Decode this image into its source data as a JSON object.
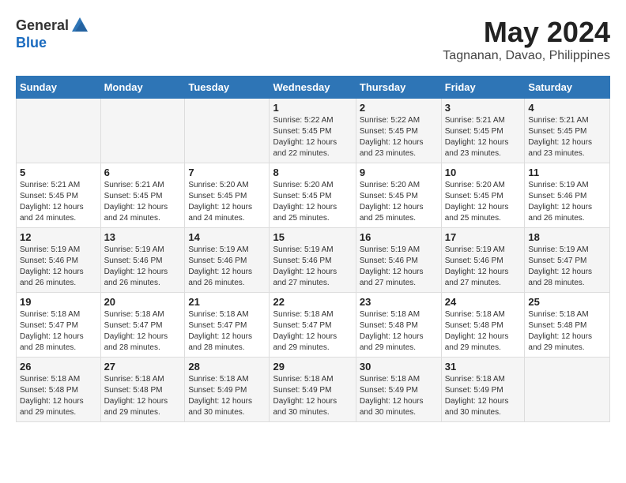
{
  "logo": {
    "general": "General",
    "blue": "Blue"
  },
  "title": "May 2024",
  "subtitle": "Tagnanan, Davao, Philippines",
  "weekdays": [
    "Sunday",
    "Monday",
    "Tuesday",
    "Wednesday",
    "Thursday",
    "Friday",
    "Saturday"
  ],
  "weeks": [
    [
      {
        "day": "",
        "info": ""
      },
      {
        "day": "",
        "info": ""
      },
      {
        "day": "",
        "info": ""
      },
      {
        "day": "1",
        "info": "Sunrise: 5:22 AM\nSunset: 5:45 PM\nDaylight: 12 hours\nand 22 minutes."
      },
      {
        "day": "2",
        "info": "Sunrise: 5:22 AM\nSunset: 5:45 PM\nDaylight: 12 hours\nand 23 minutes."
      },
      {
        "day": "3",
        "info": "Sunrise: 5:21 AM\nSunset: 5:45 PM\nDaylight: 12 hours\nand 23 minutes."
      },
      {
        "day": "4",
        "info": "Sunrise: 5:21 AM\nSunset: 5:45 PM\nDaylight: 12 hours\nand 23 minutes."
      }
    ],
    [
      {
        "day": "5",
        "info": "Sunrise: 5:21 AM\nSunset: 5:45 PM\nDaylight: 12 hours\nand 24 minutes."
      },
      {
        "day": "6",
        "info": "Sunrise: 5:21 AM\nSunset: 5:45 PM\nDaylight: 12 hours\nand 24 minutes."
      },
      {
        "day": "7",
        "info": "Sunrise: 5:20 AM\nSunset: 5:45 PM\nDaylight: 12 hours\nand 24 minutes."
      },
      {
        "day": "8",
        "info": "Sunrise: 5:20 AM\nSunset: 5:45 PM\nDaylight: 12 hours\nand 25 minutes."
      },
      {
        "day": "9",
        "info": "Sunrise: 5:20 AM\nSunset: 5:45 PM\nDaylight: 12 hours\nand 25 minutes."
      },
      {
        "day": "10",
        "info": "Sunrise: 5:20 AM\nSunset: 5:45 PM\nDaylight: 12 hours\nand 25 minutes."
      },
      {
        "day": "11",
        "info": "Sunrise: 5:19 AM\nSunset: 5:46 PM\nDaylight: 12 hours\nand 26 minutes."
      }
    ],
    [
      {
        "day": "12",
        "info": "Sunrise: 5:19 AM\nSunset: 5:46 PM\nDaylight: 12 hours\nand 26 minutes."
      },
      {
        "day": "13",
        "info": "Sunrise: 5:19 AM\nSunset: 5:46 PM\nDaylight: 12 hours\nand 26 minutes."
      },
      {
        "day": "14",
        "info": "Sunrise: 5:19 AM\nSunset: 5:46 PM\nDaylight: 12 hours\nand 26 minutes."
      },
      {
        "day": "15",
        "info": "Sunrise: 5:19 AM\nSunset: 5:46 PM\nDaylight: 12 hours\nand 27 minutes."
      },
      {
        "day": "16",
        "info": "Sunrise: 5:19 AM\nSunset: 5:46 PM\nDaylight: 12 hours\nand 27 minutes."
      },
      {
        "day": "17",
        "info": "Sunrise: 5:19 AM\nSunset: 5:46 PM\nDaylight: 12 hours\nand 27 minutes."
      },
      {
        "day": "18",
        "info": "Sunrise: 5:19 AM\nSunset: 5:47 PM\nDaylight: 12 hours\nand 28 minutes."
      }
    ],
    [
      {
        "day": "19",
        "info": "Sunrise: 5:18 AM\nSunset: 5:47 PM\nDaylight: 12 hours\nand 28 minutes."
      },
      {
        "day": "20",
        "info": "Sunrise: 5:18 AM\nSunset: 5:47 PM\nDaylight: 12 hours\nand 28 minutes."
      },
      {
        "day": "21",
        "info": "Sunrise: 5:18 AM\nSunset: 5:47 PM\nDaylight: 12 hours\nand 28 minutes."
      },
      {
        "day": "22",
        "info": "Sunrise: 5:18 AM\nSunset: 5:47 PM\nDaylight: 12 hours\nand 29 minutes."
      },
      {
        "day": "23",
        "info": "Sunrise: 5:18 AM\nSunset: 5:48 PM\nDaylight: 12 hours\nand 29 minutes."
      },
      {
        "day": "24",
        "info": "Sunrise: 5:18 AM\nSunset: 5:48 PM\nDaylight: 12 hours\nand 29 minutes."
      },
      {
        "day": "25",
        "info": "Sunrise: 5:18 AM\nSunset: 5:48 PM\nDaylight: 12 hours\nand 29 minutes."
      }
    ],
    [
      {
        "day": "26",
        "info": "Sunrise: 5:18 AM\nSunset: 5:48 PM\nDaylight: 12 hours\nand 29 minutes."
      },
      {
        "day": "27",
        "info": "Sunrise: 5:18 AM\nSunset: 5:48 PM\nDaylight: 12 hours\nand 29 minutes."
      },
      {
        "day": "28",
        "info": "Sunrise: 5:18 AM\nSunset: 5:49 PM\nDaylight: 12 hours\nand 30 minutes."
      },
      {
        "day": "29",
        "info": "Sunrise: 5:18 AM\nSunset: 5:49 PM\nDaylight: 12 hours\nand 30 minutes."
      },
      {
        "day": "30",
        "info": "Sunrise: 5:18 AM\nSunset: 5:49 PM\nDaylight: 12 hours\nand 30 minutes."
      },
      {
        "day": "31",
        "info": "Sunrise: 5:18 AM\nSunset: 5:49 PM\nDaylight: 12 hours\nand 30 minutes."
      },
      {
        "day": "",
        "info": ""
      }
    ]
  ]
}
